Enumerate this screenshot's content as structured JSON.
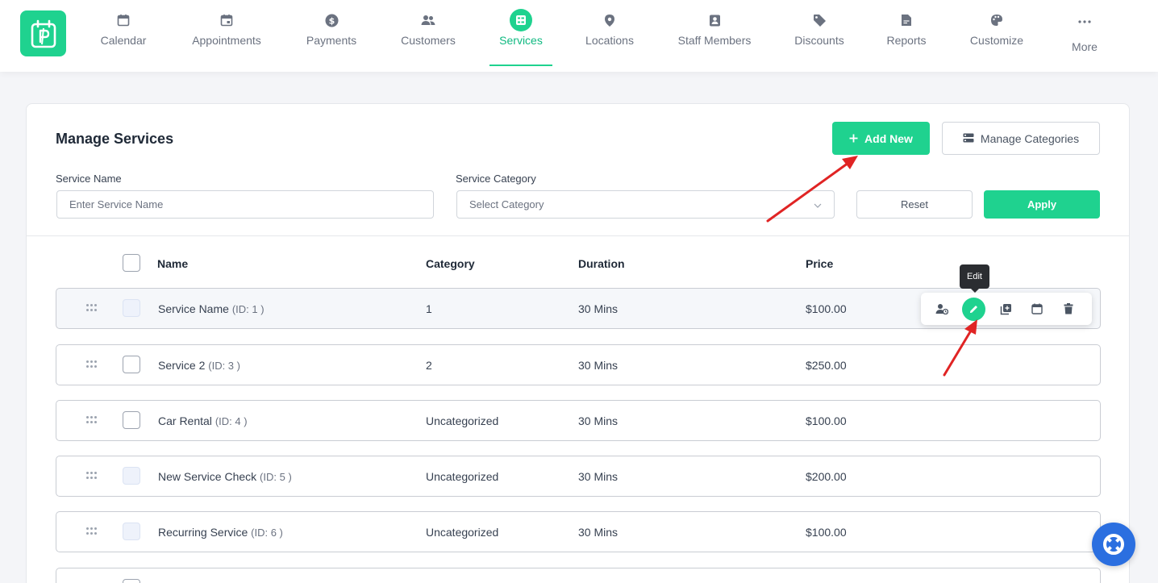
{
  "nav": {
    "items": [
      {
        "label": "Calendar",
        "icon": "calendar-icon"
      },
      {
        "label": "Appointments",
        "icon": "appointment-icon"
      },
      {
        "label": "Payments",
        "icon": "dollar-icon"
      },
      {
        "label": "Customers",
        "icon": "users-icon"
      },
      {
        "label": "Services",
        "icon": "services-icon",
        "active": true
      },
      {
        "label": "Locations",
        "icon": "location-pin-icon"
      },
      {
        "label": "Staff Members",
        "icon": "badge-icon"
      },
      {
        "label": "Discounts",
        "icon": "tag-icon"
      },
      {
        "label": "Reports",
        "icon": "report-icon"
      },
      {
        "label": "Customize",
        "icon": "palette-icon"
      },
      {
        "label": "More",
        "icon": "more-dots-icon"
      }
    ]
  },
  "page": {
    "title": "Manage Services",
    "add_new_label": "Add New",
    "manage_categories_label": "Manage Categories"
  },
  "filters": {
    "service_name_label": "Service Name",
    "service_name_placeholder": "Enter Service Name",
    "service_category_label": "Service Category",
    "service_category_placeholder": "Select Category",
    "reset_label": "Reset",
    "apply_label": "Apply"
  },
  "table": {
    "columns": [
      "Name",
      "Category",
      "Duration",
      "Price"
    ],
    "rows": [
      {
        "name": "Service Name",
        "id_text": "(ID: 1 )",
        "category": "1",
        "duration": "30 Mins",
        "price": "$100.00"
      },
      {
        "name": "Service 2",
        "id_text": "(ID: 3 )",
        "category": "2",
        "duration": "30 Mins",
        "price": "$250.00"
      },
      {
        "name": "Car Rental",
        "id_text": "(ID: 4 )",
        "category": "Uncategorized",
        "duration": "30 Mins",
        "price": "$100.00"
      },
      {
        "name": "New Service Check",
        "id_text": "(ID: 5 )",
        "category": "Uncategorized",
        "duration": "30 Mins",
        "price": "$200.00"
      },
      {
        "name": "Recurring Service",
        "id_text": "(ID: 6 )",
        "category": "Uncategorized",
        "duration": "30 Mins",
        "price": "$100.00"
      }
    ]
  },
  "tooltip": {
    "text": "Edit"
  },
  "colors": {
    "accent": "#1fd28f",
    "annotation_arrow": "#e02424",
    "help_button": "#2b6fe0"
  }
}
